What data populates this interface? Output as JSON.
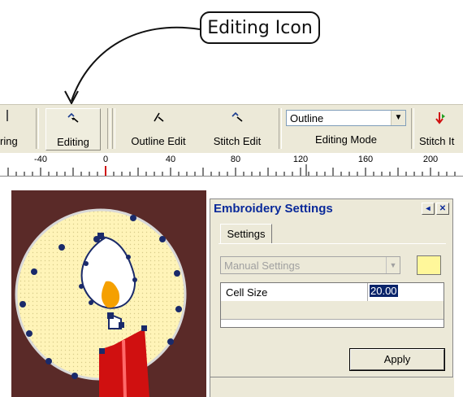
{
  "callout": {
    "text": "Editing Icon"
  },
  "toolbar": {
    "partial_label": "ring",
    "editing_label": "Editing",
    "outline_edit_label": "Outline Edit",
    "stitch_edit_label": "Stitch Edit",
    "editing_mode_value": "Outline",
    "editing_mode_label": "Editing Mode",
    "stitch_partial_label": "Stitch It"
  },
  "ruler": {
    "ticks": [
      "-40",
      "0",
      "40",
      "80",
      "120",
      "160",
      "200"
    ]
  },
  "dialog": {
    "title": "Embroidery Settings",
    "tab": "Settings",
    "preset_value": "Manual Settings",
    "swatch_color": "#fff79a",
    "cell_size_label": "Cell Size",
    "cell_size_value": "20.00",
    "apply_label": "Apply"
  },
  "colors": {
    "canvas_bg": "#5a2a28",
    "circle_fill": "#fff4b8",
    "candle": "#d01010",
    "flame": "#f5a000",
    "title_text": "#0a2a9a"
  }
}
